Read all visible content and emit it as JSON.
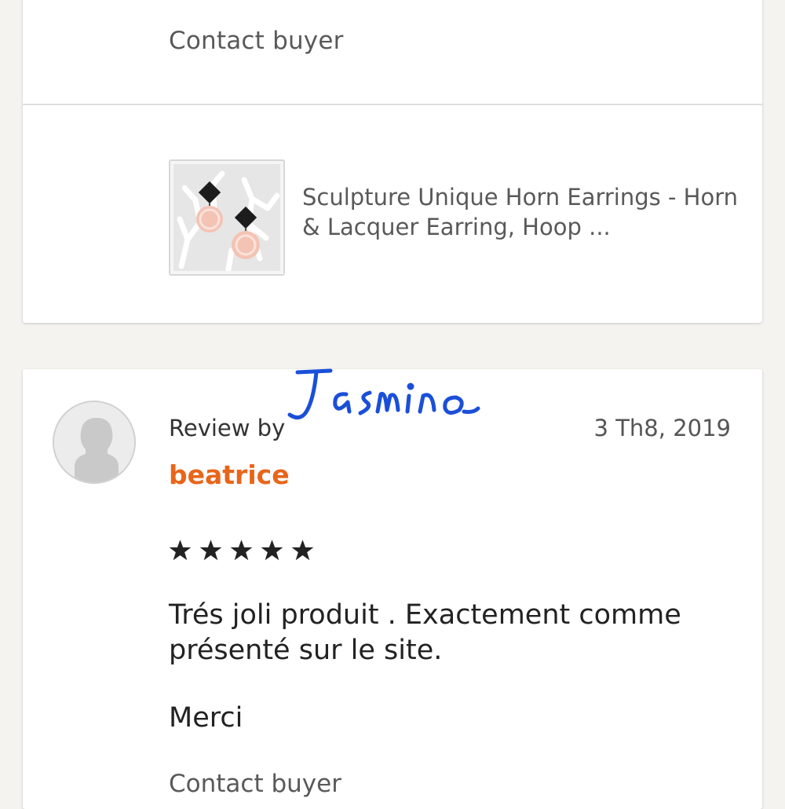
{
  "transaction": {
    "contact_label": "Contact buyer",
    "listing_title": "Sculpture Unique Horn Earrings - Horn & Lacquer Earring, Hoop ...",
    "thumbnail_icon": "earring-product-photo"
  },
  "review": {
    "avatar_icon": "default-user-avatar-icon",
    "review_by_label": "Review by",
    "reviewer_name": "beatrice",
    "date": "3 Th8, 2019",
    "rating": 5,
    "text": "Trés joli produit . Exactement comme présenté sur le site.",
    "text_2": "Merci",
    "contact_label": "Contact buyer",
    "signature": "Jasmino"
  },
  "colors": {
    "background": "#f4f3ef",
    "card": "#ffffff",
    "accent_orange": "#e8651a",
    "signature_blue": "#1a4fd8",
    "muted_text": "#595959"
  }
}
